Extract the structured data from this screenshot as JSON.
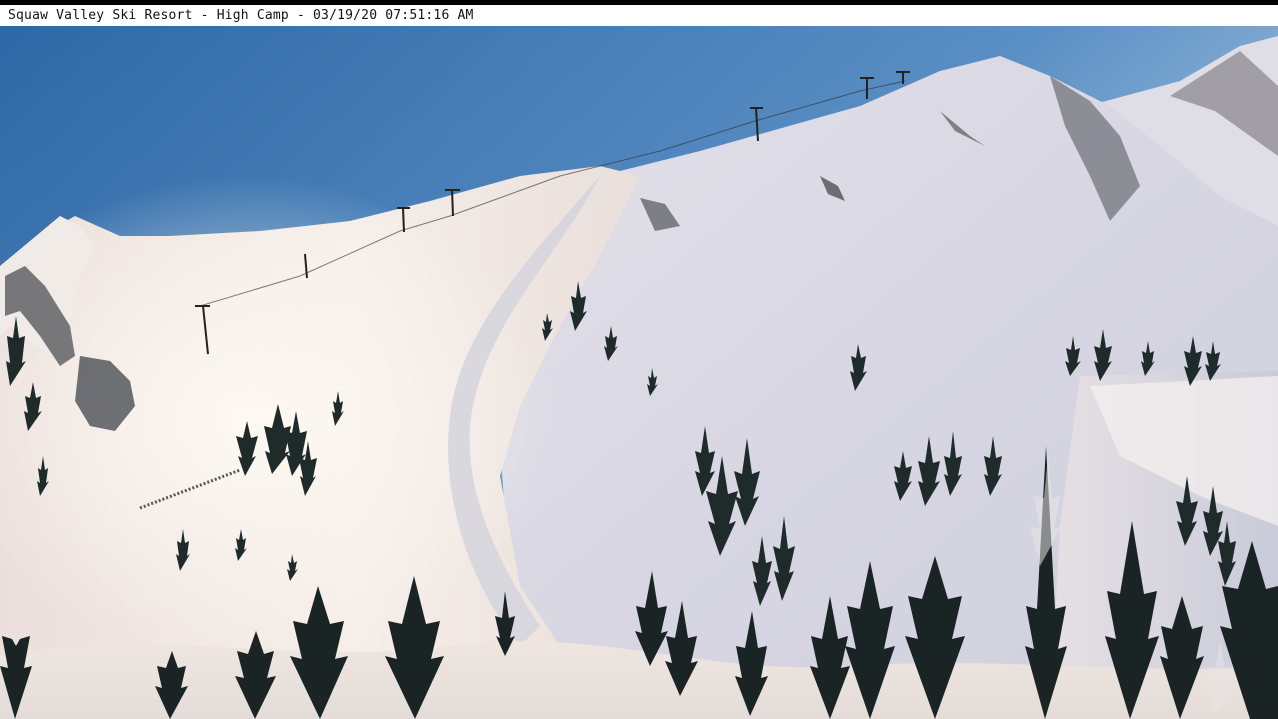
{
  "caption": {
    "text": "Squaw Valley Ski Resort - High Camp - 03/19/20 07:51:16 AM"
  },
  "colors": {
    "sky_top": "#3a6fa8",
    "sky_bottom": "#8fb6d8",
    "snow_lit": "#f4ece6",
    "snow_shadow": "#c9cad6",
    "tree": "#1e2a2a",
    "rock": "#4a4e52"
  }
}
